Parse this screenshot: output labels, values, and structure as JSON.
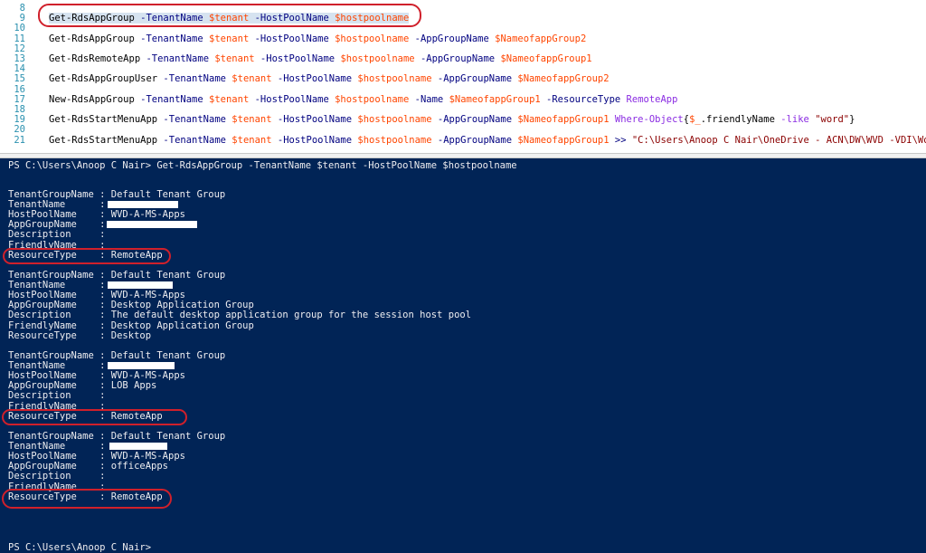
{
  "editor": {
    "lines": [
      {
        "num": "8"
      },
      {
        "num": "9",
        "parts": [
          {
            "t": "Get-RdsAppGroup",
            "c": "k"
          },
          {
            "t": " -TenantName ",
            "c": "p"
          },
          {
            "t": "$tenant",
            "c": "v"
          },
          {
            "t": " -HostPoolName ",
            "c": "p"
          },
          {
            "t": "$hostpoolname",
            "c": "v"
          }
        ]
      },
      {
        "num": "10"
      },
      {
        "num": "11",
        "parts": [
          {
            "t": "Get-RdsAppGroup",
            "c": "k"
          },
          {
            "t": " -TenantName ",
            "c": "p"
          },
          {
            "t": "$tenant",
            "c": "v"
          },
          {
            "t": " -HostPoolName ",
            "c": "p"
          },
          {
            "t": "$hostpoolname",
            "c": "v"
          },
          {
            "t": " -AppGroupName ",
            "c": "p"
          },
          {
            "t": "$NameofappGroup2",
            "c": "v"
          }
        ]
      },
      {
        "num": "12"
      },
      {
        "num": "13",
        "parts": [
          {
            "t": "Get-RdsRemoteApp",
            "c": "k"
          },
          {
            "t": " -TenantName ",
            "c": "p"
          },
          {
            "t": "$tenant",
            "c": "v"
          },
          {
            "t": " -HostPoolName ",
            "c": "p"
          },
          {
            "t": "$hostpoolname",
            "c": "v"
          },
          {
            "t": " -AppGroupName ",
            "c": "p"
          },
          {
            "t": "$NameofappGroup1",
            "c": "v"
          }
        ]
      },
      {
        "num": "14"
      },
      {
        "num": "15",
        "parts": [
          {
            "t": "Get-RdsAppGroupUser",
            "c": "k"
          },
          {
            "t": " -TenantName ",
            "c": "p"
          },
          {
            "t": "$tenant",
            "c": "v"
          },
          {
            "t": " -HostPoolName ",
            "c": "p"
          },
          {
            "t": "$hostpoolname",
            "c": "v"
          },
          {
            "t": " -AppGroupName ",
            "c": "p"
          },
          {
            "t": "$NameofappGroup2",
            "c": "v"
          }
        ]
      },
      {
        "num": "16"
      },
      {
        "num": "17",
        "parts": [
          {
            "t": "New-RdsAppGroup",
            "c": "k"
          },
          {
            "t": " -TenantName ",
            "c": "p"
          },
          {
            "t": "$tenant",
            "c": "v"
          },
          {
            "t": " -HostPoolName ",
            "c": "p"
          },
          {
            "t": "$hostpoolname",
            "c": "v"
          },
          {
            "t": " -Name ",
            "c": "p"
          },
          {
            "t": "$NameofappGroup1",
            "c": "v"
          },
          {
            "t": " -ResourceType ",
            "c": "p"
          },
          {
            "t": "RemoteApp",
            "c": "s"
          }
        ]
      },
      {
        "num": "18"
      },
      {
        "num": "19",
        "parts": [
          {
            "t": "Get-RdsStartMenuApp",
            "c": "k"
          },
          {
            "t": " -TenantName ",
            "c": "p"
          },
          {
            "t": "$tenant",
            "c": "v"
          },
          {
            "t": " -HostPoolName ",
            "c": "p"
          },
          {
            "t": "$hostpoolname",
            "c": "v"
          },
          {
            "t": " -AppGroupName ",
            "c": "p"
          },
          {
            "t": "$NameofappGroup1",
            "c": "v"
          },
          {
            "t": " Where-Object",
            "c": "s"
          },
          {
            "t": "{",
            "c": "k"
          },
          {
            "t": "$_",
            "c": "v"
          },
          {
            "t": ".friendlyName ",
            "c": "k"
          },
          {
            "t": "-like ",
            "c": "s"
          },
          {
            "t": "\"word\"",
            "c": "str"
          },
          {
            "t": "}",
            "c": "k"
          }
        ]
      },
      {
        "num": "20"
      },
      {
        "num": "21",
        "parts": [
          {
            "t": "Get-RdsStartMenuApp",
            "c": "k"
          },
          {
            "t": " -TenantName ",
            "c": "p"
          },
          {
            "t": "$tenant",
            "c": "v"
          },
          {
            "t": " -HostPoolName ",
            "c": "p"
          },
          {
            "t": "$hostpoolname",
            "c": "v"
          },
          {
            "t": " -AppGroupName ",
            "c": "p"
          },
          {
            "t": "$NameofappGroup1",
            "c": "v"
          },
          {
            "t": " >> ",
            "c": "p"
          },
          {
            "t": "\"C:\\Users\\Anoop C Nair\\OneDrive - ACN\\DW\\WVD -VDI\\Work\\",
            "c": "str"
          }
        ]
      }
    ]
  },
  "console": {
    "prompt_command": "PS C:\\Users\\Anoop C Nair> Get-RdsAppGroup -TenantName $tenant -HostPoolName $hostpoolname",
    "records": [
      [
        "TenantGroupName : Default Tenant Group",
        "TenantName      :",
        "HostPoolName    : WVD-A-MS-Apps",
        "AppGroupName    :",
        "Description     :",
        "FriendlyName    :",
        "ResourceType    : RemoteApp"
      ],
      [
        "TenantGroupName : Default Tenant Group",
        "TenantName      :",
        "HostPoolName    : WVD-A-MS-Apps",
        "AppGroupName    : Desktop Application Group",
        "Description     : The default desktop application group for the session host pool",
        "FriendlyName    : Desktop Application Group",
        "ResourceType    : Desktop"
      ],
      [
        "TenantGroupName : Default Tenant Group",
        "TenantName      :",
        "HostPoolName    : WVD-A-MS-Apps",
        "AppGroupName    : LOB Apps",
        "Description     :",
        "FriendlyName    :",
        "ResourceType    : RemoteApp"
      ],
      [
        "TenantGroupName : Default Tenant Group",
        "TenantName      :",
        "HostPoolName    : WVD-A-MS-Apps",
        "AppGroupName    : officeApps",
        "Description     :",
        "FriendlyName    :",
        "ResourceType    : RemoteApp"
      ]
    ],
    "final_prompt": "PS C:\\Users\\Anoop C Nair>"
  },
  "colors": {
    "console_background": "#012456",
    "annotation_ring": "#d0202b"
  }
}
